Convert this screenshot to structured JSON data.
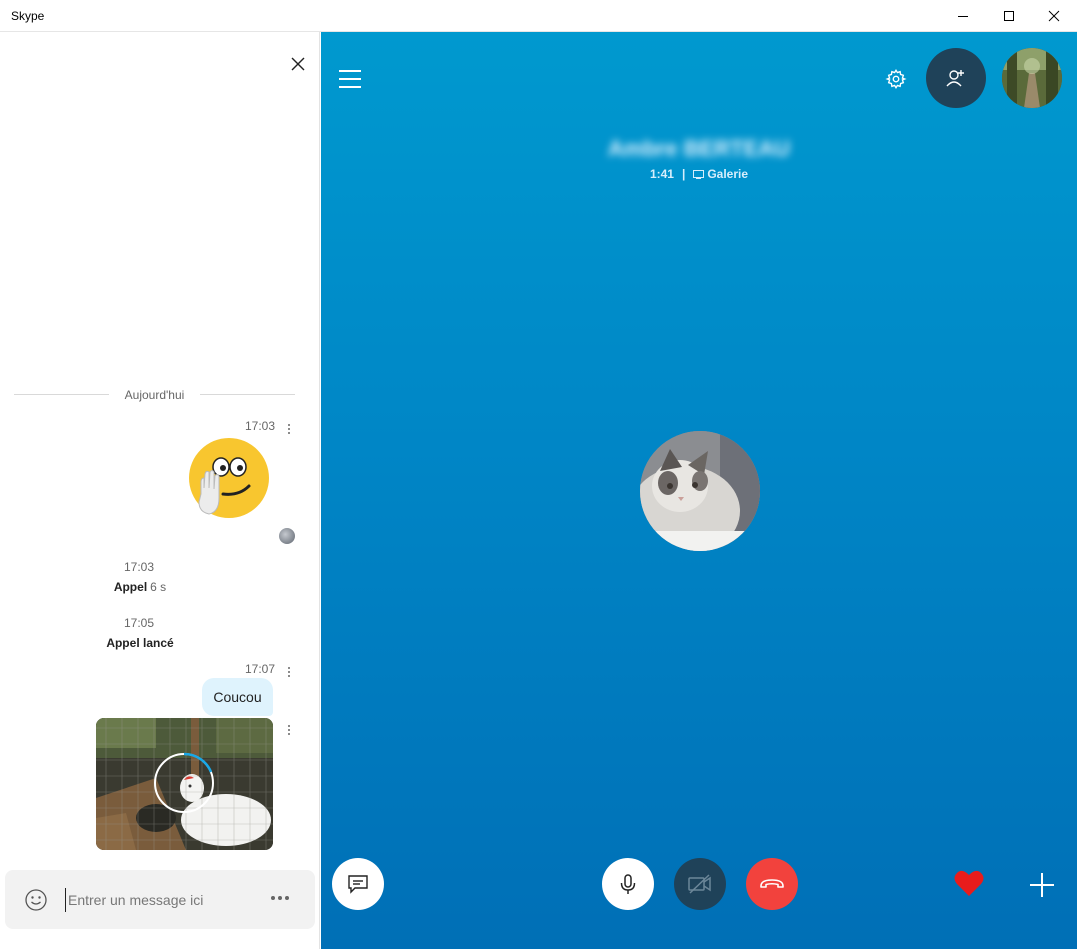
{
  "window": {
    "title": "Skype",
    "controls": [
      "minimize-icon",
      "maximize-icon",
      "close-icon"
    ]
  },
  "chat": {
    "date_divider": "Aujourd'hui",
    "messages": [
      {
        "time": "17:03",
        "type": "emoticon",
        "icon": "wave-emoji-icon"
      },
      {
        "time": "17:03",
        "type": "call",
        "label": "Appel",
        "duration": "6 s"
      },
      {
        "time": "17:05",
        "type": "call",
        "label": "Appel lancé"
      },
      {
        "time": "17:07",
        "type": "text",
        "text": "Coucou"
      },
      {
        "type": "photo",
        "icon": "chicken-photo",
        "status": "uploading"
      }
    ],
    "composer": {
      "placeholder": "Entrer un message ici",
      "value": ""
    }
  },
  "call": {
    "caller_name": "Ambre BERTEAU",
    "duration": "1:41",
    "view_mode": "Galerie",
    "controls": {
      "chat": "chat-icon",
      "mic": "microphone-icon",
      "video": "video-off-icon",
      "hangup": "hang-up-icon",
      "reaction": "heart-icon",
      "more": "plus-icon"
    },
    "colors": {
      "background_top": "#0099cf",
      "background_bottom": "#006fb6",
      "hangup": "#f2423d",
      "video_button": "#1f4259",
      "heart": "#e81c1c"
    }
  }
}
